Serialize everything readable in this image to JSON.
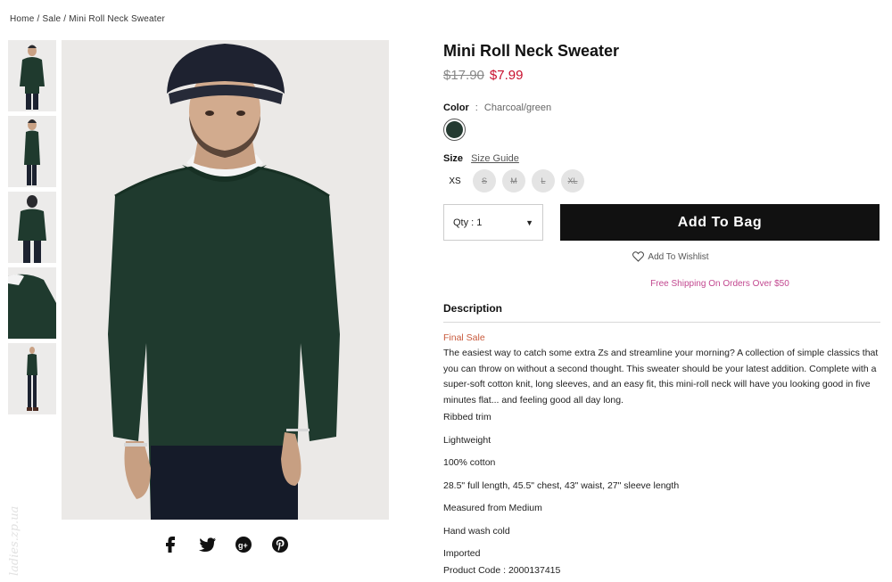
{
  "breadcrumb": {
    "home": "Home",
    "sale": "Sale",
    "current": "Mini Roll Neck Sweater",
    "separator": "/"
  },
  "product": {
    "title": "Mini Roll Neck Sweater",
    "old_price": "$17.90",
    "new_price": "$7.99",
    "color_label": "Color",
    "color_separator": ":",
    "color_value": "Charcoal/green",
    "swatch_color": "#243a31",
    "size_label": "Size",
    "size_guide": "Size Guide",
    "sizes": [
      {
        "label": "XS",
        "available": true
      },
      {
        "label": "S",
        "available": false
      },
      {
        "label": "M",
        "available": false
      },
      {
        "label": "L",
        "available": false
      },
      {
        "label": "XL",
        "available": false
      }
    ],
    "qty_label": "Qty : 1",
    "add_to_bag": "Add To Bag",
    "wishlist": "Add To Wishlist",
    "shipping": "Free Shipping On Orders Over $50"
  },
  "description": {
    "heading": "Description",
    "final_sale": "Final Sale",
    "body": "The easiest way to catch some extra Zs and streamline your morning? A collection of simple classics that you can throw on without a second thought. This sweater should be your latest addition. Complete with a super-soft cotton knit, long sleeves, and an easy fit, this mini-roll neck will have you looking good in five minutes flat... and feeling good all day long.",
    "features": [
      "Ribbed trim",
      "Lightweight",
      "100% cotton",
      "28.5\" full length, 45.5\" chest, 43\" waist, 27\" sleeve length",
      "Measured from Medium",
      "Hand wash cold",
      "Imported"
    ],
    "product_code": "Product Code : 2000137415"
  },
  "social": [
    "facebook-icon",
    "twitter-icon",
    "google-plus-icon",
    "pinterest-icon"
  ],
  "thumbnails": [
    "front-view",
    "side-view",
    "back-view",
    "sleeve-detail",
    "full-body-view"
  ],
  "watermark": "ladies.zp.ua",
  "colors": {
    "sweater": "#1f3a2e",
    "price_sale": "#c8102e",
    "shipping": "#c2478f",
    "final_sale": "#c85a3c",
    "button": "#111111"
  }
}
